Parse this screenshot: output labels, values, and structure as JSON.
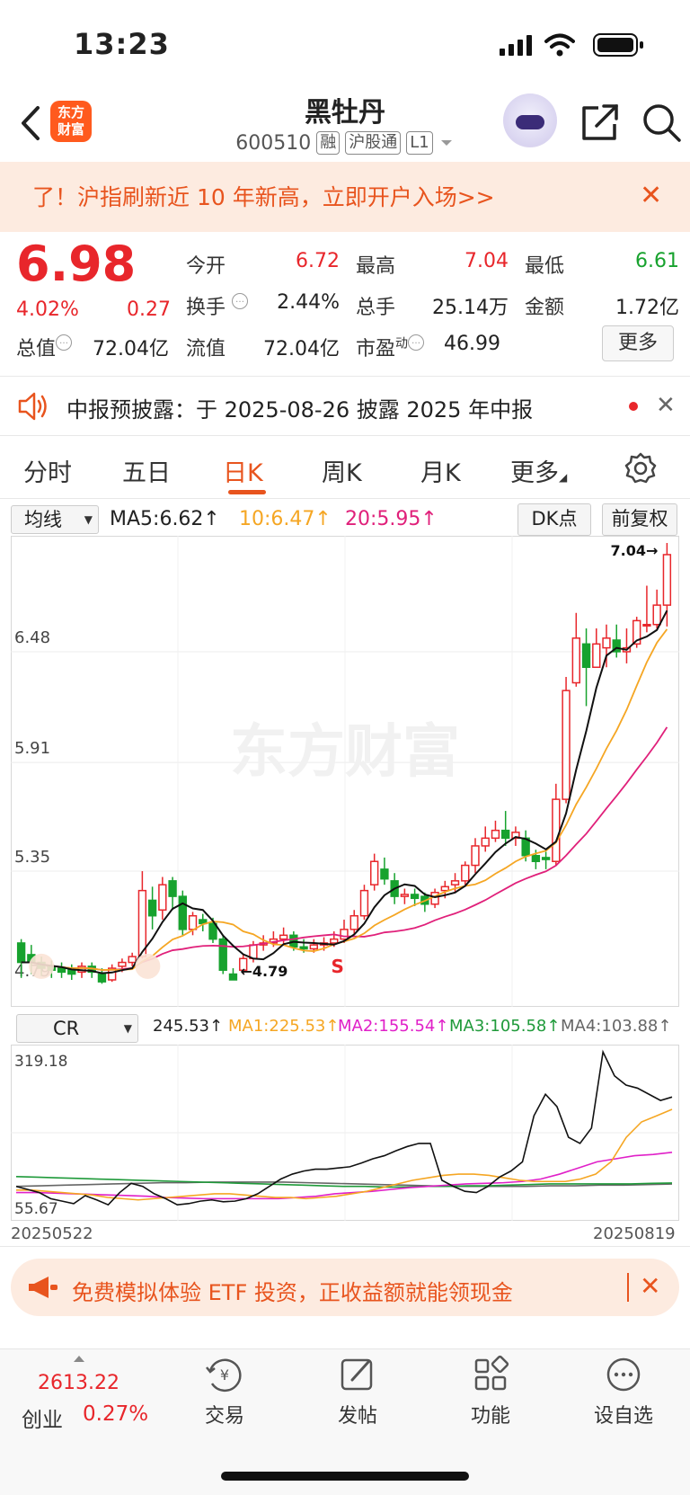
{
  "status_bar": {
    "time": "13:23"
  },
  "header": {
    "logo_line1": "东方",
    "logo_line2": "财富",
    "stock_name": "黑牡丹",
    "stock_code": "600510",
    "tags": [
      "融",
      "沪股通",
      "L1"
    ]
  },
  "banner": {
    "text": "了！沪指刷新近 10 年新高，立即开户入场>>"
  },
  "quote": {
    "price": "6.98",
    "change_pct": "4.02%",
    "change": "0.27",
    "fields": {
      "open_label": "今开",
      "open": "6.72",
      "high_label": "最高",
      "high": "7.04",
      "low_label": "最低",
      "low": "6.61",
      "turnover_label": "换手",
      "turnover": "2.44%",
      "volume_label": "总手",
      "volume": "25.14万",
      "amount_label": "金额",
      "amount": "1.72亿",
      "mcap_label": "总值",
      "mcap": "72.04亿",
      "float_label": "流值",
      "float": "72.04亿",
      "pe_label": "市盈",
      "pe_sup": "动",
      "pe": "46.99",
      "more": "更多"
    }
  },
  "notice": {
    "text": "中报预披露：于 2025-08-26 披露 2025 年中报"
  },
  "tabs": [
    "分时",
    "五日",
    "日K",
    "周K",
    "月K",
    "更多"
  ],
  "active_tab": "日K",
  "ma_row": {
    "selector": "均线",
    "ma5": "MA5:6.62↑",
    "ma10": "10:6.47↑",
    "ma20": "20:5.95↑",
    "dk_button": "DK点",
    "adjust_button": "前复权"
  },
  "kline": {
    "y_labels": [
      "7.04",
      "6.48",
      "5.91",
      "5.35",
      "4.79"
    ],
    "high_marker": "7.04",
    "low_marker": "4.79",
    "signal": "S",
    "watermark": "东方财富"
  },
  "cr_row": {
    "selector": "CR",
    "cr": "245.53↑",
    "ma1": "MA1:225.53↑",
    "ma2": "MA2:155.54↑",
    "ma3": "MA3:105.58↑",
    "ma4": "MA4:103.88↑",
    "y_max": "319.18",
    "y_min": "55.67"
  },
  "dates": {
    "start": "20250522",
    "end": "20250819"
  },
  "promo": {
    "text": "免费模拟体验 ETF 投资，正收益额就能领现金"
  },
  "bottom_nav": {
    "index_value": "2613.22",
    "index_name": "创业",
    "index_pct": "0.27%",
    "items": [
      {
        "label": "交易",
        "icon": "trade-icon"
      },
      {
        "label": "发帖",
        "icon": "edit-icon"
      },
      {
        "label": "功能",
        "icon": "grid-icon"
      },
      {
        "label": "设自选",
        "icon": "more-dots-icon"
      }
    ]
  },
  "colors": {
    "up": "#e8262b",
    "down": "#17a22e",
    "accent": "#e8541e",
    "ma5": "#111111",
    "ma10": "#f5a623",
    "ma20": "#e0207a",
    "ma3": "#1f9a3a",
    "ma4": "#666666"
  },
  "chart_data": [
    {
      "type": "candlestick",
      "title": "",
      "y_ticks": [
        7.04,
        6.48,
        5.91,
        5.35,
        4.79
      ],
      "ylim": [
        4.79,
        7.04
      ],
      "grid": true,
      "candles": [
        [
          4.98,
          4.88,
          5.0,
          4.8
        ],
        [
          4.92,
          4.88,
          4.97,
          4.82
        ],
        [
          4.88,
          4.85,
          4.91,
          4.81
        ],
        [
          4.86,
          4.84,
          4.89,
          4.8
        ],
        [
          4.85,
          4.83,
          4.88,
          4.8
        ],
        [
          4.84,
          4.82,
          4.87,
          4.79
        ],
        [
          4.83,
          4.86,
          4.88,
          4.8
        ],
        [
          4.86,
          4.83,
          4.88,
          4.8
        ],
        [
          4.82,
          4.78,
          4.85,
          4.77
        ],
        [
          4.79,
          4.85,
          4.87,
          4.78
        ],
        [
          4.86,
          4.88,
          4.9,
          4.83
        ],
        [
          4.88,
          4.91,
          4.93,
          4.86
        ],
        [
          4.91,
          5.25,
          5.35,
          4.9
        ],
        [
          5.2,
          5.12,
          5.27,
          5.05
        ],
        [
          5.15,
          5.28,
          5.32,
          5.1
        ],
        [
          5.3,
          5.22,
          5.32,
          5.15
        ],
        [
          5.22,
          5.05,
          5.25,
          5.02
        ],
        [
          5.05,
          5.12,
          5.14,
          5.02
        ],
        [
          5.1,
          5.08,
          5.13,
          5.04
        ],
        [
          5.08,
          5.0,
          5.11,
          4.98
        ],
        [
          5.0,
          4.84,
          5.02,
          4.82
        ],
        [
          4.82,
          4.79,
          4.85,
          4.79
        ],
        [
          4.84,
          4.9,
          4.92,
          4.82
        ],
        [
          4.9,
          4.97,
          4.99,
          4.88
        ],
        [
          4.97,
          4.98,
          5.02,
          4.94
        ],
        [
          4.98,
          5.0,
          5.04,
          4.96
        ],
        [
          5.0,
          5.02,
          5.06,
          4.97
        ],
        [
          5.02,
          4.96,
          5.04,
          4.94
        ],
        [
          4.96,
          4.95,
          5.0,
          4.93
        ],
        [
          4.95,
          4.97,
          5.0,
          4.93
        ],
        [
          4.97,
          4.98,
          5.01,
          4.94
        ],
        [
          4.98,
          5.0,
          5.04,
          4.96
        ],
        [
          5.0,
          5.05,
          5.1,
          4.98
        ],
        [
          5.05,
          5.12,
          5.15,
          5.02
        ],
        [
          5.12,
          5.25,
          5.28,
          5.1
        ],
        [
          5.28,
          5.4,
          5.44,
          5.25
        ],
        [
          5.36,
          5.31,
          5.42,
          5.28
        ],
        [
          5.3,
          5.22,
          5.34,
          5.18
        ],
        [
          5.22,
          5.23,
          5.26,
          5.18
        ],
        [
          5.23,
          5.21,
          5.26,
          5.17
        ],
        [
          5.22,
          5.18,
          5.24,
          5.14
        ],
        [
          5.18,
          5.24,
          5.26,
          5.16
        ],
        [
          5.25,
          5.27,
          5.3,
          5.21
        ],
        [
          5.28,
          5.3,
          5.34,
          5.24
        ],
        [
          5.3,
          5.38,
          5.4,
          5.28
        ],
        [
          5.38,
          5.48,
          5.52,
          5.34
        ],
        [
          5.48,
          5.52,
          5.58,
          5.45
        ],
        [
          5.52,
          5.56,
          5.61,
          5.5
        ],
        [
          5.56,
          5.52,
          5.66,
          5.48
        ],
        [
          5.52,
          5.55,
          5.58,
          5.48
        ],
        [
          5.52,
          5.43,
          5.56,
          5.4
        ],
        [
          5.43,
          5.4,
          5.46,
          5.36
        ],
        [
          5.42,
          5.41,
          5.45,
          5.36
        ],
        [
          5.4,
          5.72,
          5.8,
          5.38
        ],
        [
          5.72,
          6.28,
          6.35,
          5.7
        ],
        [
          6.32,
          6.55,
          6.68,
          6.3
        ],
        [
          6.52,
          6.4,
          6.6,
          6.2
        ],
        [
          6.4,
          6.52,
          6.6,
          6.45
        ],
        [
          6.5,
          6.55,
          6.62,
          6.4
        ],
        [
          6.54,
          6.48,
          6.62,
          6.45
        ],
        [
          6.48,
          6.5,
          6.6,
          6.42
        ],
        [
          6.52,
          6.64,
          6.66,
          6.5
        ],
        [
          6.62,
          6.62,
          6.82,
          6.58
        ],
        [
          6.62,
          6.72,
          6.8,
          6.6
        ],
        [
          6.72,
          6.98,
          7.04,
          6.61
        ]
      ]
    },
    {
      "type": "line",
      "title": "",
      "ylim": [
        55.67,
        319.18
      ],
      "series": [
        {
          "name": "CR",
          "values": [
            100,
            95,
            90,
            80,
            76,
            72,
            85,
            78,
            70,
            90,
            105,
            100,
            88,
            80,
            70,
            72,
            76,
            78,
            75,
            76,
            80,
            88,
            100,
            112,
            120,
            125,
            128,
            128,
            130,
            132,
            138,
            145,
            150,
            158,
            165,
            170,
            170,
            110,
            100,
            92,
            90,
            100,
            115,
            125,
            140,
            215,
            250,
            230,
            180,
            170,
            195,
            319,
            280,
            265,
            260,
            250,
            240,
            245.53
          ]
        },
        {
          "name": "MA1",
          "values": [
            94,
            94,
            92,
            90,
            88,
            86,
            82,
            80,
            78,
            80,
            82,
            84,
            86,
            88,
            88,
            86,
            84,
            82,
            82,
            80,
            82,
            84,
            88,
            92,
            98,
            104,
            110,
            114,
            118,
            120,
            120,
            118,
            114,
            110,
            108,
            108,
            108,
            112,
            120,
            140,
            180,
            205,
            215,
            225.53
          ]
        },
        {
          "name": "MA2",
          "values": [
            90,
            90,
            89,
            88,
            87,
            86,
            85,
            84,
            82,
            81,
            80,
            80,
            80,
            80,
            80,
            82,
            84,
            88,
            90,
            92,
            95,
            98,
            100,
            102,
            104,
            105,
            106,
            108,
            112,
            120,
            130,
            140,
            145,
            150,
            152,
            155.54
          ]
        },
        {
          "name": "MA3",
          "values": [
            116,
            115,
            114,
            113,
            112,
            111,
            110,
            109,
            108,
            107,
            106,
            105,
            104,
            103,
            102,
            101,
            100,
            100,
            99,
            99,
            100,
            100,
            101,
            101,
            102,
            103,
            104,
            104,
            104,
            104,
            104,
            105,
            105.58
          ]
        },
        {
          "name": "MA4",
          "values": [
            100,
            101,
            102,
            103,
            104,
            105,
            106,
            106,
            107,
            107,
            107,
            107,
            106,
            105,
            104,
            103,
            102,
            101,
            100,
            100,
            100,
            100,
            101,
            101,
            102,
            102,
            103,
            103.88
          ]
        }
      ]
    }
  ]
}
